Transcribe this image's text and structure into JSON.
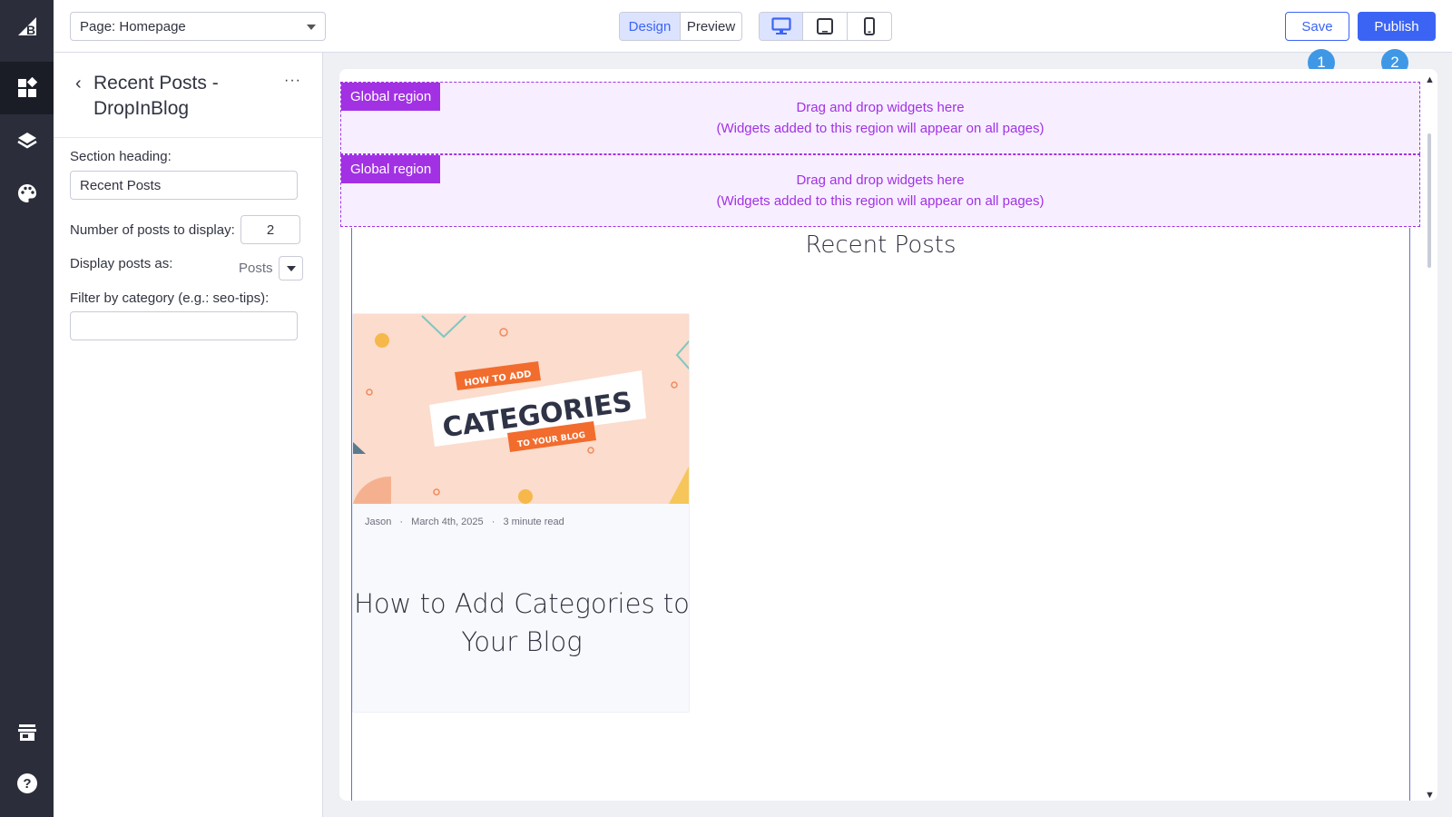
{
  "topbar": {
    "page_select": "Page: Homepage",
    "mode_design": "Design",
    "mode_preview": "Preview",
    "save_label": "Save",
    "publish_label": "Publish"
  },
  "badges": [
    "1",
    "2"
  ],
  "panel": {
    "title": "Recent Posts - DropInBlog",
    "more": "···",
    "back": "‹",
    "section_heading_label": "Section heading:",
    "section_heading_value": "Recent Posts",
    "num_posts_label": "Number of posts to display:",
    "num_posts_value": "2",
    "display_as_label": "Display posts as:",
    "display_as_value": "Posts",
    "filter_label": "Filter by category (e.g.: seo-tips):",
    "filter_value": ""
  },
  "regions": [
    {
      "tag": "Global region",
      "line1": "Drag and drop widgets here",
      "line2": "(Widgets added to this region will appear on all pages)"
    },
    {
      "tag": "Global region",
      "line1": "Drag and drop widgets here",
      "line2": "(Widgets added to this region will appear on all pages)"
    }
  ],
  "recent_posts": {
    "heading": "Recent Posts",
    "card": {
      "img_top": "HOW TO ADD",
      "img_main": "CATEGORIES",
      "img_bottom": "TO YOUR BLOG",
      "author": "Jason",
      "sep": "·",
      "date": "March 4th, 2025",
      "read": "3 minute read",
      "title": "How to Add Categories to Your Blog"
    }
  },
  "colors": {
    "accent": "#3c64f4",
    "region": "#a231e4",
    "badge": "#3f98e6",
    "rail": "#2b2e3a"
  },
  "icons": {
    "rail": [
      "brand-logo-icon",
      "widgets-icon",
      "layers-icon",
      "palette-icon",
      "storefront-icon",
      "help-icon"
    ],
    "devices": [
      "desktop-icon",
      "tablet-icon",
      "mobile-icon"
    ]
  }
}
